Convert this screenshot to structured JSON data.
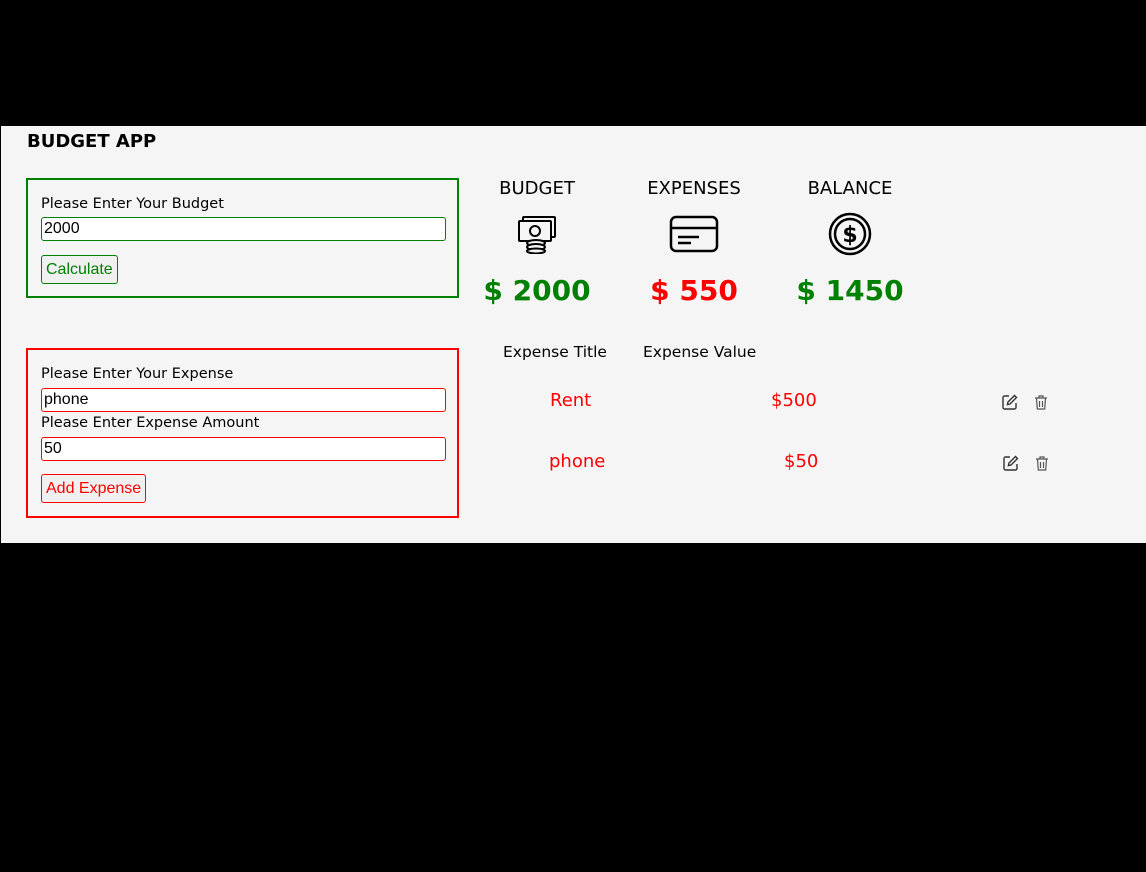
{
  "app": {
    "title": "BUDGET APP"
  },
  "budget_form": {
    "label": "Please Enter Your Budget",
    "value": "2000",
    "button": "Calculate"
  },
  "expense_form": {
    "title_label": "Please Enter Your Expense",
    "title_value": "phone",
    "amount_label": "Please Enter Expense Amount",
    "amount_value": "50",
    "button": "Add Expense"
  },
  "summary": {
    "budget": {
      "label": "BUDGET",
      "value": "$ 2000",
      "icon": "money-icon"
    },
    "expenses": {
      "label": "EXPENSES",
      "value": "$ 550",
      "icon": "credit-card-icon"
    },
    "balance": {
      "label": "BALANCE",
      "value": "$ 1450",
      "icon": "dollar-coin-icon"
    }
  },
  "expense_list": {
    "headers": [
      "Expense Title",
      "Expense Value"
    ],
    "rows": [
      {
        "title": "Rent",
        "value": "$500"
      },
      {
        "title": "phone",
        "value": "$50"
      }
    ]
  },
  "colors": {
    "positive": "#008000",
    "negative": "#ff0000",
    "panel_bg": "#f5f5f5",
    "outer_bg": "#000000"
  }
}
